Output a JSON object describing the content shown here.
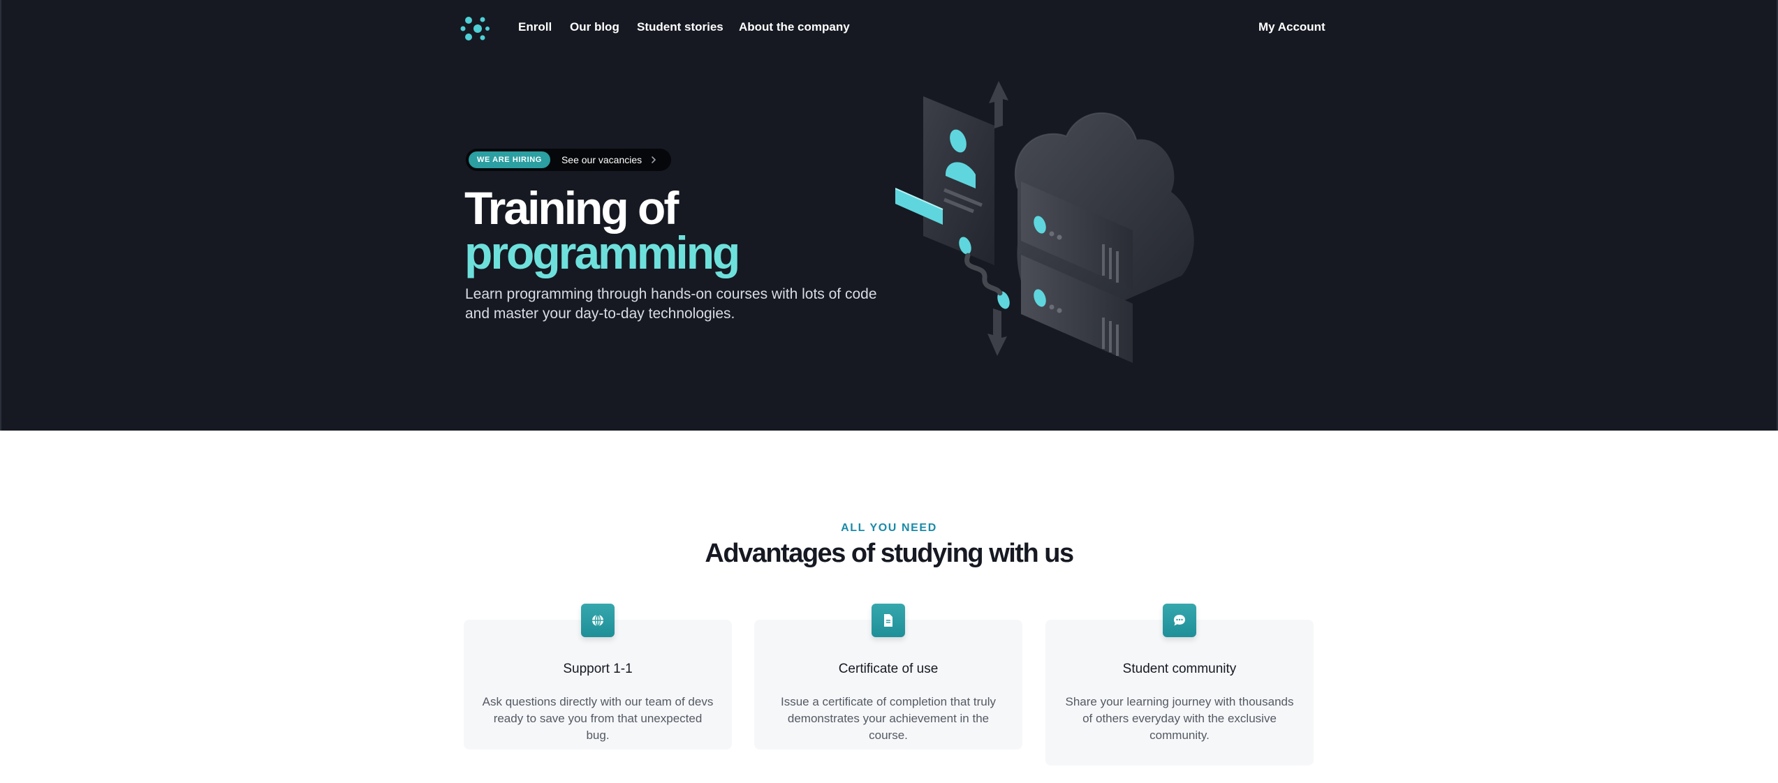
{
  "nav": {
    "logo_icon": "cluster-logo-icon",
    "links": [
      "Enroll",
      "Our blog",
      "Student stories",
      "About the company"
    ],
    "account": "My Account"
  },
  "hero": {
    "badge": "WE ARE HIRING",
    "vacancies": "See our vacancies",
    "title_line1": "Training of",
    "title_line2": "programming",
    "subtitle": "Learn programming through hands-on courses with lots of code and master your day-to-day technologies.",
    "illustration_icon": "cloud-servers-illustration"
  },
  "advantages": {
    "eyebrow": "ALL YOU NEED",
    "title": "Advantages of studying with us",
    "cards": [
      {
        "icon": "globe-icon",
        "title": "Support 1-1",
        "description": "Ask questions directly with our team of devs ready to save you from that unexpected bug."
      },
      {
        "icon": "document-icon",
        "title": "Certificate of use",
        "description": "Issue a certificate of completion that truly demonstrates your achievement in the course."
      },
      {
        "icon": "chat-bubble-icon",
        "title": "Student community",
        "description": "Share your learning journey with thousands of others everyday with the exclusive community."
      }
    ]
  },
  "colors": {
    "hero_bg": "#161922",
    "accent": "#6ee0dc",
    "badge": "#2b9fa2",
    "eyebrow": "#1a8aa8"
  }
}
